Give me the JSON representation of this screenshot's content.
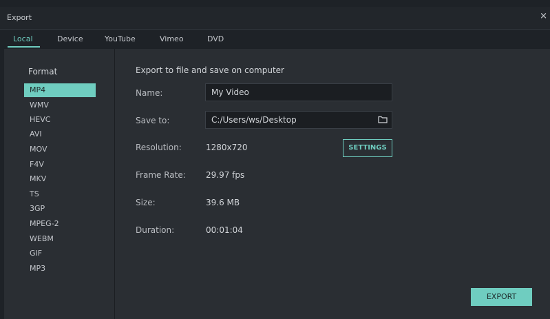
{
  "window": {
    "title": "Export",
    "close_glyph": "×"
  },
  "tabs": [
    {
      "label": "Local",
      "active": true
    },
    {
      "label": "Device"
    },
    {
      "label": "YouTube"
    },
    {
      "label": "Vimeo"
    },
    {
      "label": "DVD"
    }
  ],
  "sidebar": {
    "heading": "Format",
    "selected": "MP4",
    "formats": [
      "MP4",
      "WMV",
      "HEVC",
      "AVI",
      "MOV",
      "F4V",
      "MKV",
      "TS",
      "3GP",
      "MPEG-2",
      "WEBM",
      "GIF",
      "MP3"
    ]
  },
  "main": {
    "heading": "Export to file and save on computer",
    "name": {
      "label": "Name:",
      "value": "My Video"
    },
    "save_to": {
      "label": "Save to:",
      "value": "C:/Users/ws/Desktop",
      "icon": "folder-icon"
    },
    "resolution": {
      "label": "Resolution:",
      "value": "1280x720"
    },
    "settings_button": "SETTINGS",
    "frame_rate": {
      "label": "Frame Rate:",
      "value": "29.97 fps"
    },
    "size": {
      "label": "Size:",
      "value": "39.6 MB"
    },
    "duration": {
      "label": "Duration:",
      "value": "00:01:04"
    }
  },
  "export_button": "EXPORT",
  "colors": {
    "accent": "#6fcdc0",
    "panel": "#2a2e33",
    "background": "#1e2227"
  }
}
